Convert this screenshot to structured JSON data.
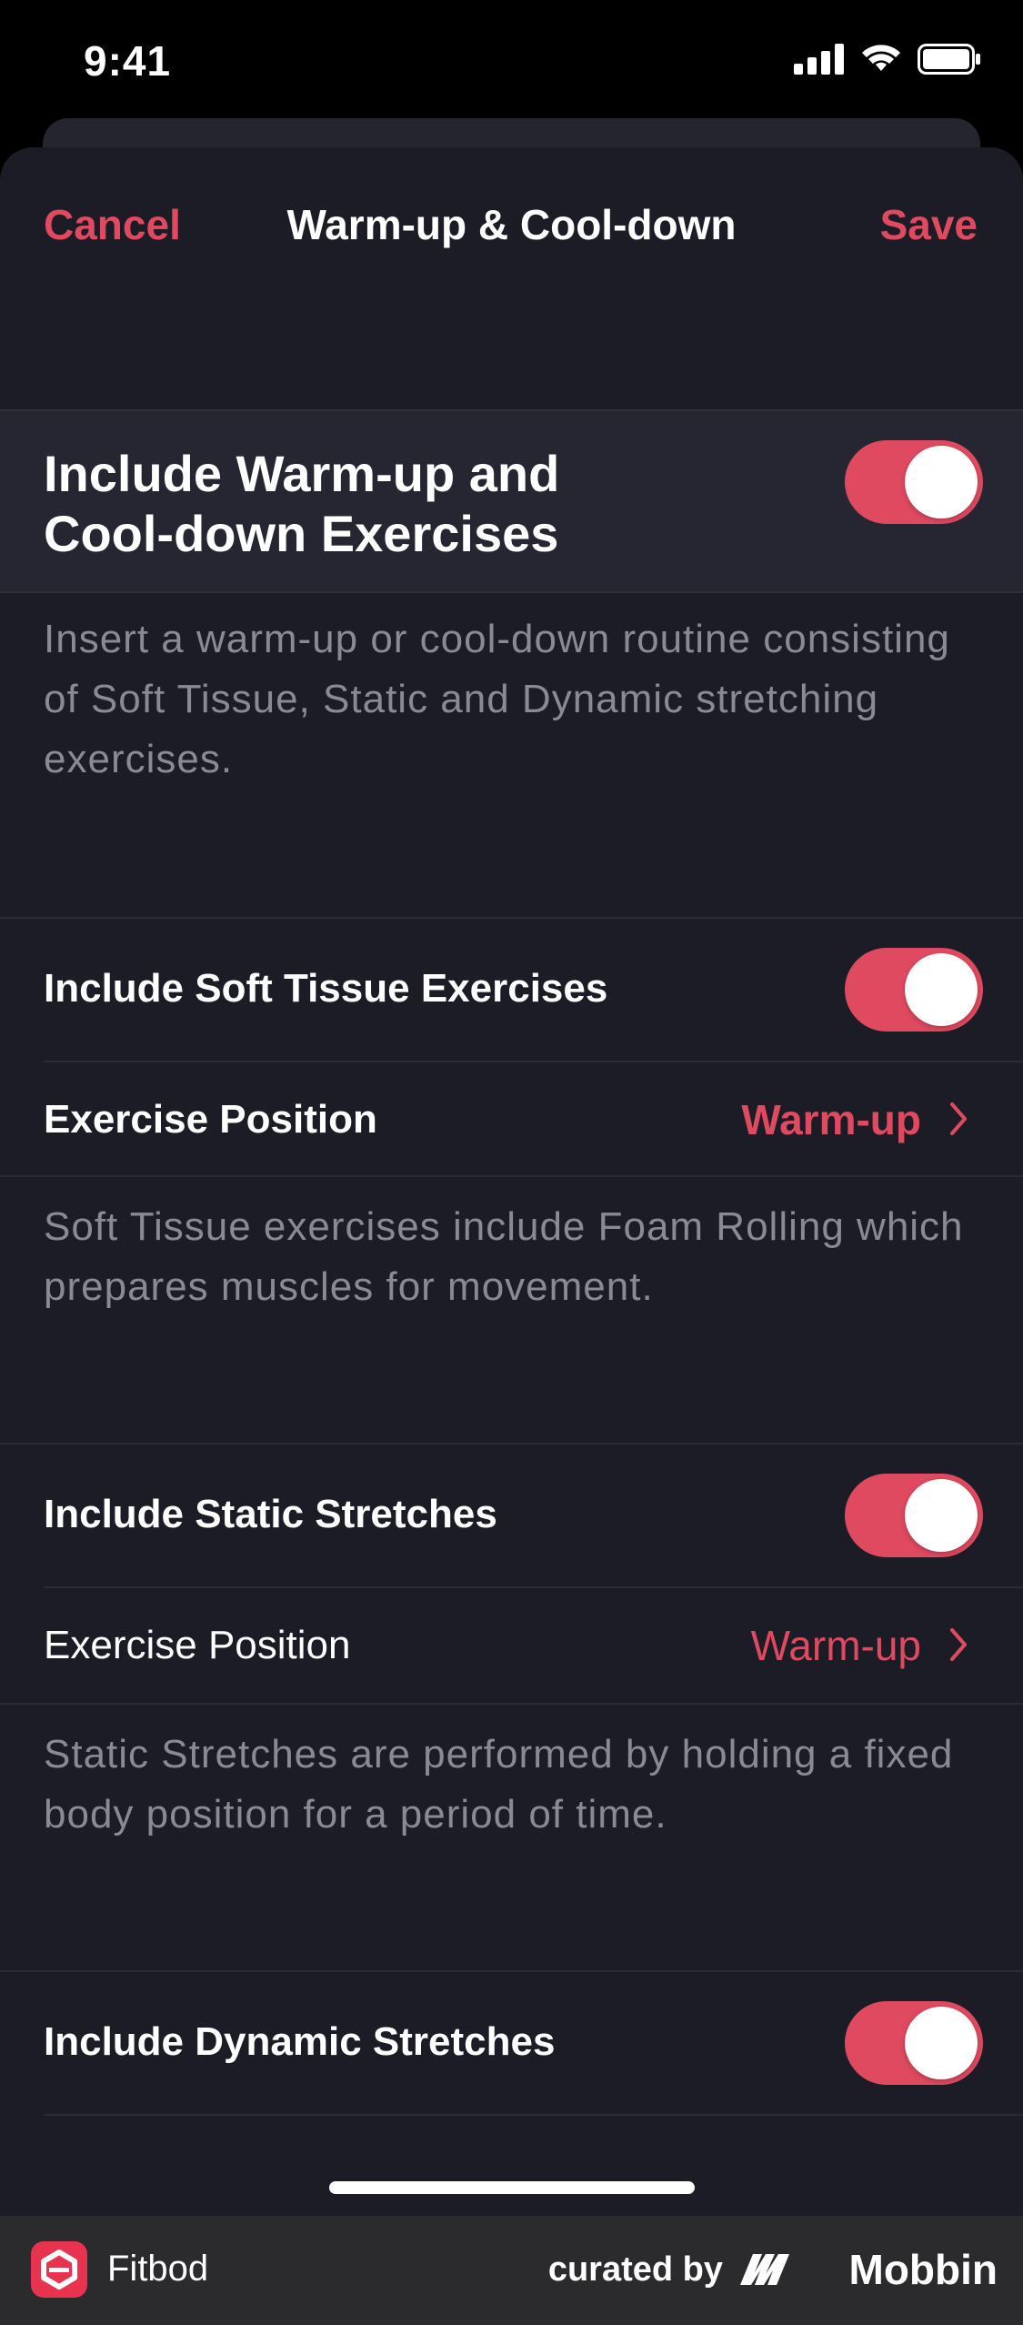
{
  "status_bar": {
    "time": "9:41"
  },
  "nav": {
    "cancel": "Cancel",
    "title": "Warm-up & Cool-down",
    "save": "Save"
  },
  "main": {
    "label": "Include Warm-up and Cool-down Exercises",
    "toggle_on": true,
    "description": "Insert a warm-up or cool-down routine consisting of Soft Tissue, Static and Dynamic stretching exercises."
  },
  "soft_tissue": {
    "label": "Include Soft Tissue Exercises",
    "toggle_on": true,
    "position_label": "Exercise Position",
    "position_value": "Warm-up",
    "description": "Soft Tissue exercises include Foam Rolling which prepares muscles for movement."
  },
  "static": {
    "label": "Include Static Stretches",
    "toggle_on": true,
    "position_label": "Exercise Position",
    "position_value": "Warm-up",
    "description": "Static Stretches are performed by holding a fixed body position for a period of time."
  },
  "dynamic": {
    "label": "Include Dynamic Stretches",
    "toggle_on": true
  },
  "footer": {
    "app_name": "Fitbod",
    "curated_by": "curated by",
    "brand": "Mobbin"
  },
  "colors": {
    "accent": "#e04a60",
    "sheet_bg": "#1c1c26",
    "text_muted": "#8a8a96"
  }
}
